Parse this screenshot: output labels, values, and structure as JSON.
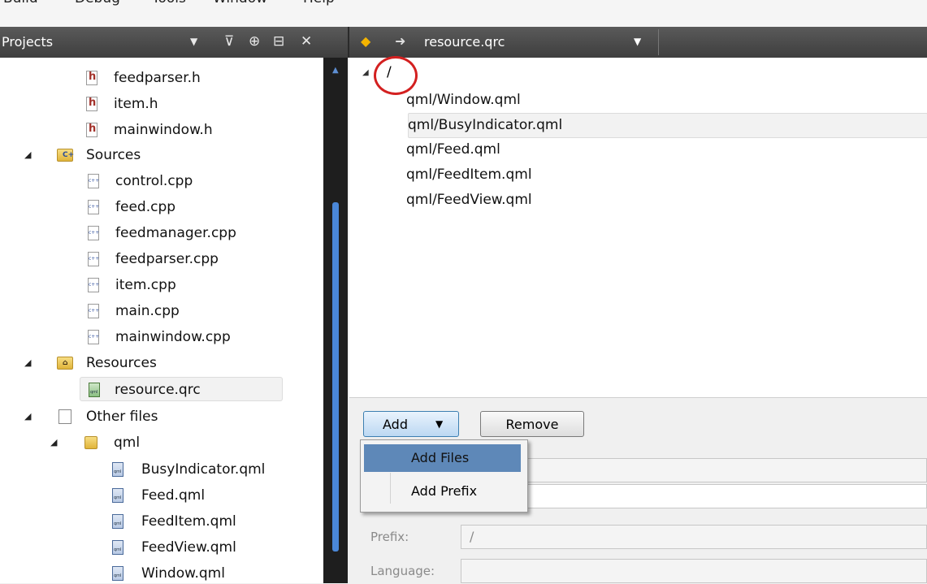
{
  "menubar": {
    "items": [
      "Build",
      "Debug",
      "Tools",
      "Window",
      "Help"
    ]
  },
  "projects_panel": {
    "title": "Projects",
    "icons": [
      "chevron-down-icon",
      "filter-icon",
      "link-icon",
      "split-icon",
      "close-icon"
    ]
  },
  "tree": {
    "headers": [
      "feedparser.h",
      "item.h",
      "mainwindow.h"
    ],
    "sources_label": "Sources",
    "sources": [
      "control.cpp",
      "feed.cpp",
      "feedmanager.cpp",
      "feedparser.cpp",
      "item.cpp",
      "main.cpp",
      "mainwindow.cpp"
    ],
    "resources_label": "Resources",
    "resource_file": "resource.qrc",
    "other_label": "Other files",
    "qml_folder": "qml",
    "qml_files": [
      "BusyIndicator.qml",
      "Feed.qml",
      "FeedItem.qml",
      "FeedView.qml",
      "Window.qml"
    ]
  },
  "editor": {
    "filename": "resource.qrc",
    "prefix": "/",
    "resources": [
      "qml/Window.qml",
      "qml/BusyIndicator.qml",
      "qml/Feed.qml",
      "qml/FeedItem.qml",
      "qml/FeedView.qml"
    ]
  },
  "bottom": {
    "add_label": "Add",
    "remove_label": "Remove",
    "menu_items": [
      "Add Files",
      "Add Prefix"
    ],
    "prefix_label": "Prefix:",
    "prefix_value": "/",
    "language_label": "Language:",
    "language_value": ""
  },
  "colors": {
    "header_bg": "#4a4a4a",
    "scroll_thumb": "#4a87d8",
    "menu_highlight": "#5e88b8",
    "annotation": "#d32020"
  }
}
